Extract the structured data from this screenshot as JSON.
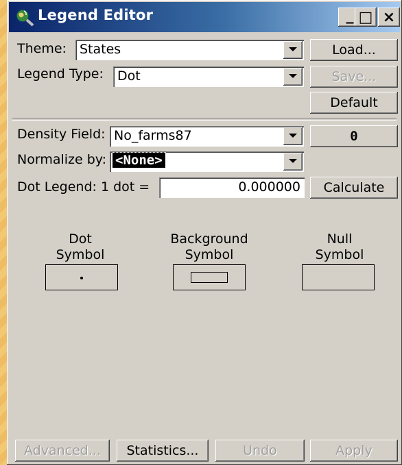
{
  "window": {
    "title": "Legend Editor",
    "icon": "globe-magnifier-icon"
  },
  "title_buttons": {
    "minimize": "_",
    "maximize": "□",
    "close": "×"
  },
  "theme": {
    "label": "Theme:",
    "value": "States"
  },
  "legend_type": {
    "label": "Legend Type:",
    "value": "Dot"
  },
  "buttons": {
    "load": "Load...",
    "save": "Save...",
    "default": "Default",
    "calculate": "Calculate",
    "density_num": "0"
  },
  "density_field": {
    "label": "Density Field:",
    "value": "No_farms87"
  },
  "normalize_by": {
    "label": "Normalize by:",
    "value": "<None>"
  },
  "dot_legend": {
    "label": "Dot Legend: 1 dot =",
    "value": "0.000000"
  },
  "symbols": {
    "dot": {
      "line1": "Dot",
      "line2": "Symbol"
    },
    "background": {
      "line1": "Background",
      "line2": "Symbol"
    },
    "null": {
      "line1": "Null",
      "line2": "Symbol"
    }
  },
  "footer": {
    "advanced": "Advanced...",
    "statistics": "Statistics...",
    "undo": "Undo",
    "apply": "Apply"
  }
}
